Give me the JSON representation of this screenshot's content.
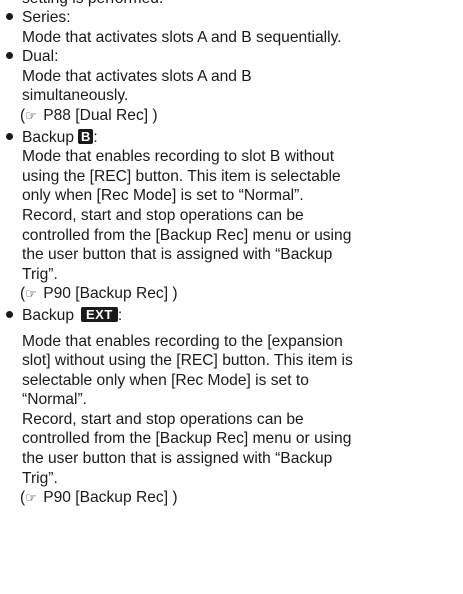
{
  "top_fragment": "setting is performed.",
  "items": [
    {
      "title": "Series:",
      "desc": [
        "Mode that activates slots A and B sequentially."
      ]
    },
    {
      "title": "Dual:",
      "desc": [
        "Mode that activates slots A and B",
        "simultaneously."
      ],
      "ref": "P88 [Dual Rec] )"
    },
    {
      "title": "Backup",
      "badge": "B",
      "desc": [
        "Mode that enables recording to slot B without",
        "using the [REC] button. This item is selectable",
        "only when [Rec Mode] is set to “Normal”.",
        "Record, start and stop operations can be",
        "controlled from the [Backup Rec] menu or using",
        "the user button that is assigned with “Backup",
        "Trig”."
      ],
      "ref": "P90 [Backup Rec] )"
    },
    {
      "title": "Backup",
      "badge": "EXT",
      "desc": [
        "Mode that enables recording to the [expansion",
        "slot] without using the [REC] button. This item is",
        "selectable only when [Rec Mode] is set to",
        "“Normal”.",
        "Record, start and stop operations can be",
        "controlled from the [Backup Rec] menu or using",
        "the user button that is assigned with “Backup",
        "Trig”."
      ],
      "ref": "P90 [Backup Rec] )"
    }
  ],
  "ref_prefix": "(",
  "ref_icon": "pointing-hand-icon",
  "ref_glyph": "☞"
}
